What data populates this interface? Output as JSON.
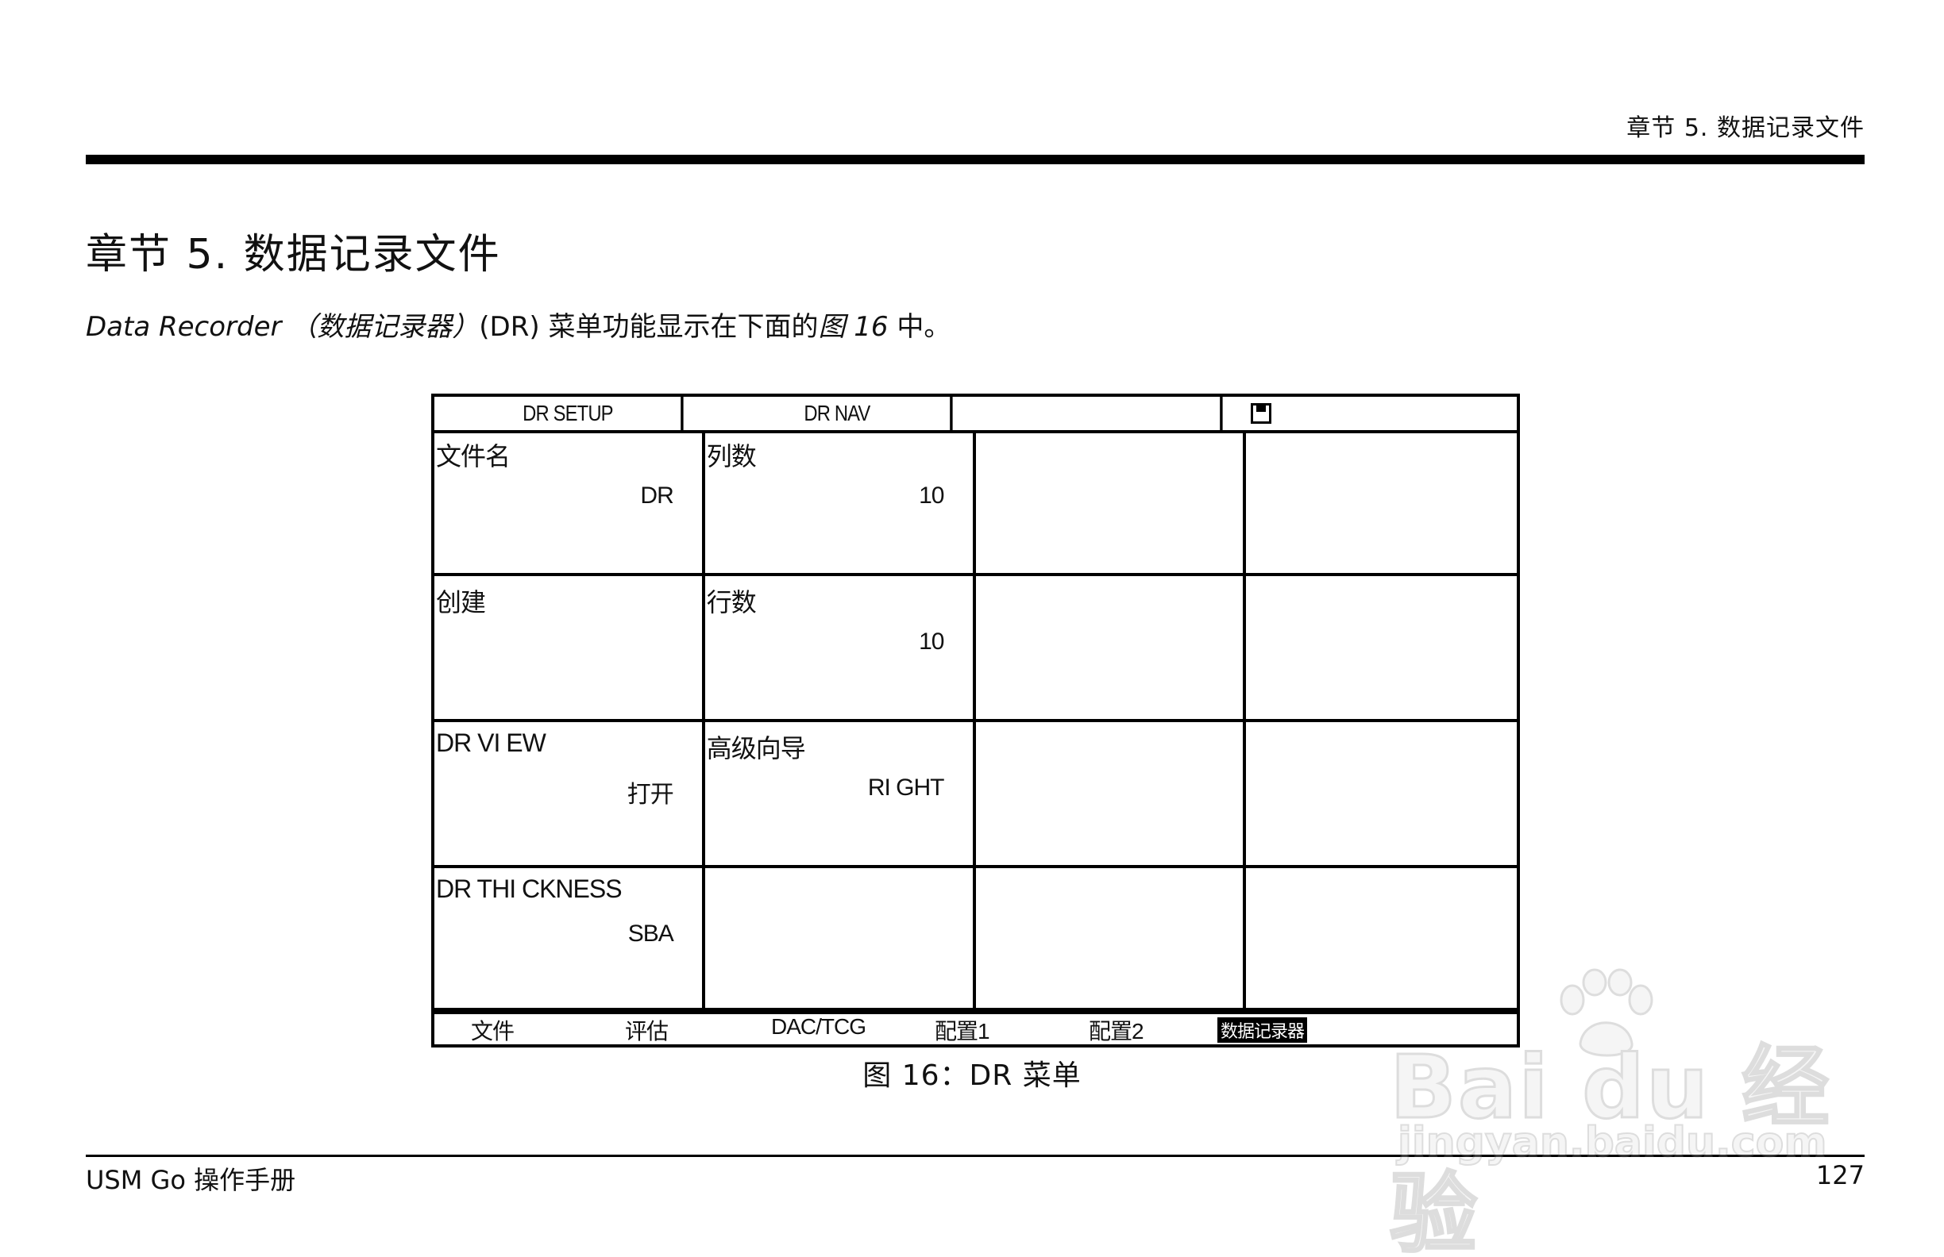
{
  "header": {
    "running_title": "章节 5. 数据记录文件"
  },
  "chapter": {
    "title": "章节 5. 数据记录文件"
  },
  "intro": {
    "part1": "Data Recorder （数据记录器）",
    "part2": "(DR) 菜单功能显示在下面的",
    "part3": "图 16",
    "part4": " 中。"
  },
  "screen": {
    "tabs": [
      "DR SETUP",
      "DR NAV",
      "",
      ""
    ],
    "tab_icon": "save-disk-icon",
    "rows": [
      [
        {
          "label": "文件名",
          "value": "DR"
        },
        {
          "label": "列数",
          "value": "10"
        },
        {
          "label": "",
          "value": ""
        },
        {
          "label": "",
          "value": ""
        }
      ],
      [
        {
          "label": "创建",
          "value": ""
        },
        {
          "label": "行数",
          "value": "10"
        },
        {
          "label": "",
          "value": ""
        },
        {
          "label": "",
          "value": ""
        }
      ],
      [
        {
          "label": "DR VI EW",
          "value": "打开"
        },
        {
          "label": "高级向导",
          "value": "RI GHT"
        },
        {
          "label": "",
          "value": ""
        },
        {
          "label": "",
          "value": ""
        }
      ],
      [
        {
          "label": "DR THI CKNESS",
          "value": "SBA"
        },
        {
          "label": "",
          "value": ""
        },
        {
          "label": "",
          "value": ""
        },
        {
          "label": "",
          "value": ""
        }
      ]
    ],
    "softkeys": [
      "文件",
      "评估",
      "DAC/TCG",
      "配置1",
      "配置2",
      "数据记录器"
    ]
  },
  "figure": {
    "caption": "图 16：DR 菜单"
  },
  "footer": {
    "manual": "USM Go 操作手册",
    "page": "127"
  },
  "watermark": {
    "logo": "Bai du 经验",
    "url": "jingyan.baidu.com"
  }
}
